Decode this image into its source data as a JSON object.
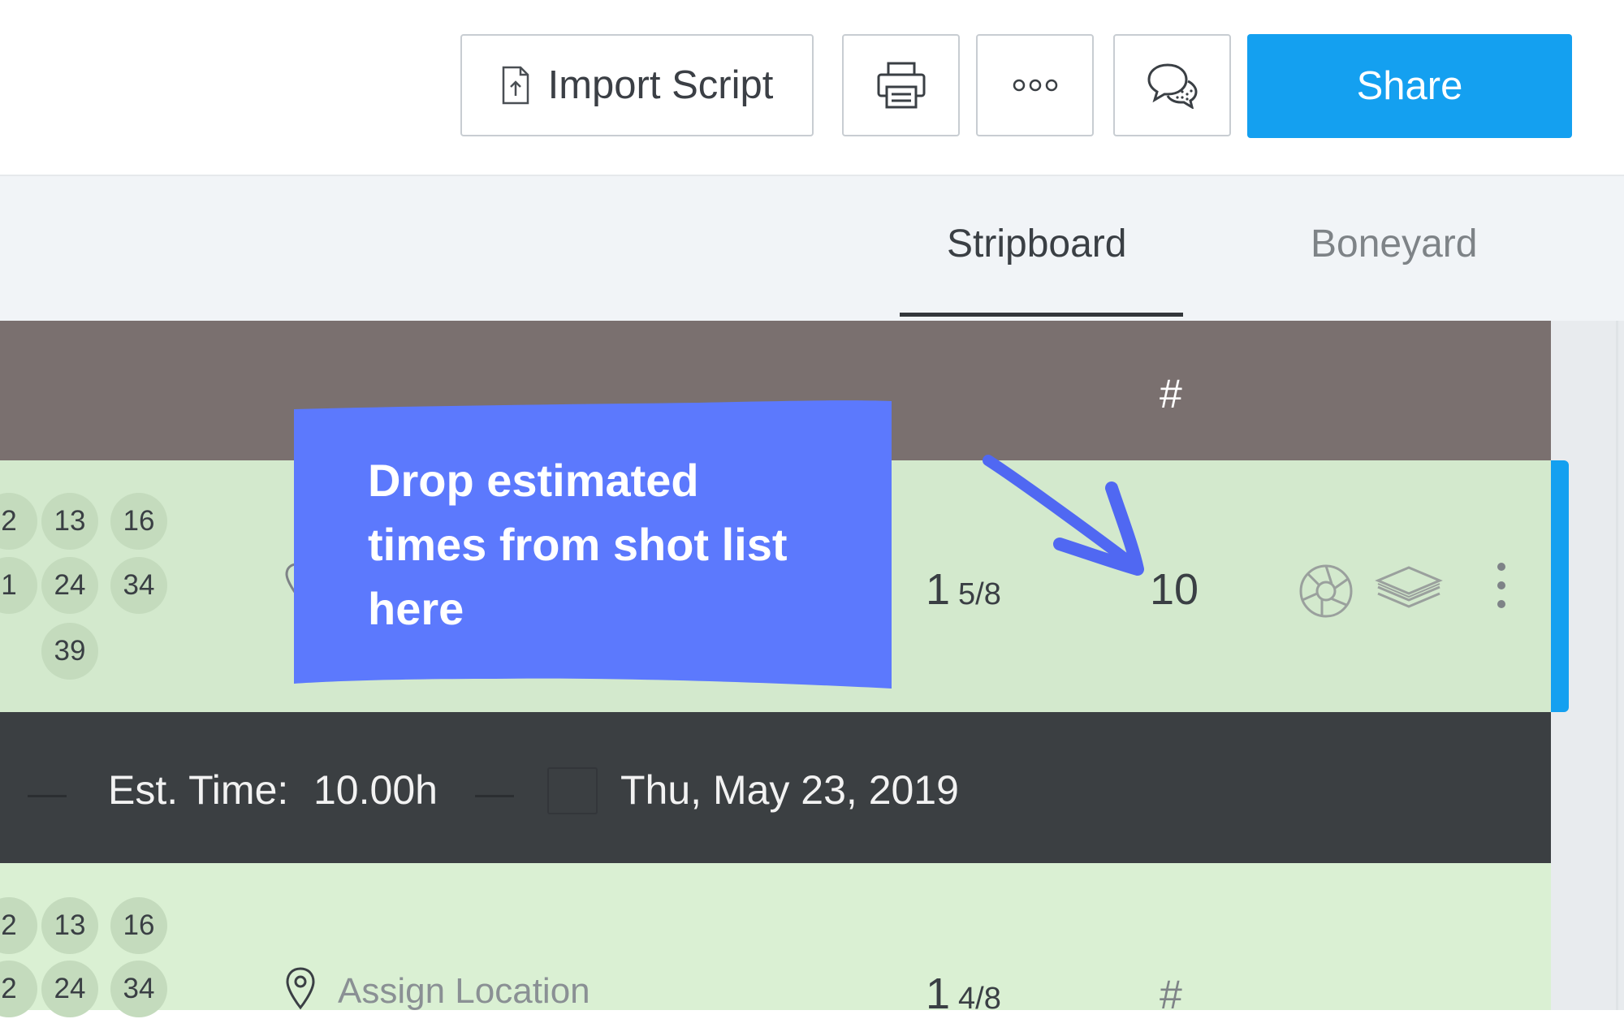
{
  "toolbar": {
    "import_label": "Import Script",
    "share_label": "Share",
    "icons": {
      "import": "file-upload-icon",
      "print": "printer-icon",
      "more": "more-options-icon",
      "comments": "comments-icon"
    }
  },
  "tabs": [
    {
      "label": "Stripboard",
      "active": true
    },
    {
      "label": "Boneyard",
      "active": false
    }
  ],
  "header": {
    "number_label": "#"
  },
  "scene1": {
    "cast": [
      "2",
      "13",
      "16",
      "1",
      "24",
      "34",
      "39"
    ],
    "pages_whole": "1",
    "pages_fraction": "5/8",
    "scene_number": "10",
    "color": "#d3e9cd"
  },
  "day_break": {
    "est_label": "Est. Time:",
    "est_value": "10.00h",
    "date": "Thu, May 23, 2019"
  },
  "scene2": {
    "cast": [
      "2",
      "13",
      "16",
      "2",
      "24",
      "34"
    ],
    "location_placeholder": "Assign Location",
    "pages_whole": "1",
    "pages_fraction": "4/8",
    "number_label": "#"
  },
  "callout": {
    "line1": "Drop estimated",
    "line2": "times from shot list",
    "line3": "here",
    "color": "#5c79fd"
  },
  "colors": {
    "accent": "#14a0f0",
    "header_strip": "#7a706f",
    "day_break": "#3b3f42"
  }
}
